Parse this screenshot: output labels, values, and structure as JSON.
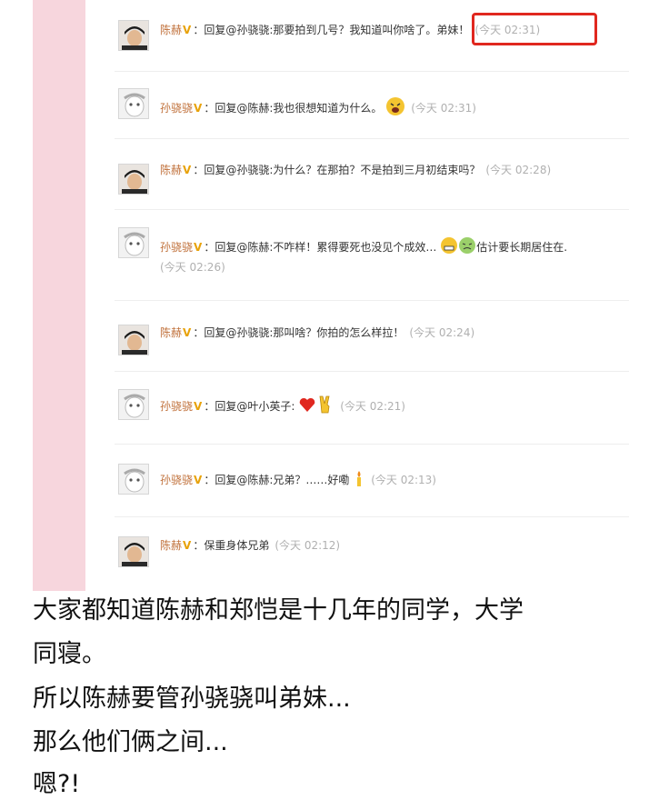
{
  "comments": [
    {
      "user": "陈赫",
      "body": "回复@孙骁骁:那要拍到几号？我知道叫你啥了。",
      "highlight": "弟妹！",
      "time": "(今天 02:31)"
    },
    {
      "user": "孙骁骁",
      "body": "回复@陈赫:我也很想知道为什么。",
      "time": "(今天 02:31)"
    },
    {
      "user": "陈赫",
      "body": "回复@孙骁骁:为什么？在那拍？不是拍到三月初结束吗？",
      "time": "(今天 02:28)"
    },
    {
      "user": "孙骁骁",
      "body": "回复@陈赫:不咋样！累得要死也没见个成效…",
      "body_after": "估计要长期居住在.",
      "time": "(今天 02:26)"
    },
    {
      "user": "陈赫",
      "body": "回复@孙骁骁:那叫啥？你拍的怎么样拉！",
      "time": "(今天 02:24)"
    },
    {
      "user": "孙骁骁",
      "body": "回复@叶小英子:",
      "time": "(今天 02:21)"
    },
    {
      "user": "孙骁骁",
      "body": "回复@陈赫:兄弟？……好嘞",
      "time": "(今天 02:13)"
    },
    {
      "user": "陈赫",
      "body": "保重身体兄弟",
      "time": "(今天 02:12)"
    }
  ],
  "verified_mark": "V",
  "caption": {
    "line1": "大家都知道陈赫和郑恺是十几年的同学，大学",
    "line2": "同寝。",
    "line3": "所以陈赫要管孙骁骁叫弟妹...",
    "line4": "那么他们俩之间...",
    "line5": "嗯?!"
  },
  "colors": {
    "username": "#c0703a",
    "verified": "#e8a20a",
    "highlight_border": "#e0271f",
    "sidebar": "#f7d6dd",
    "timestamp": "#b0b0b0"
  }
}
